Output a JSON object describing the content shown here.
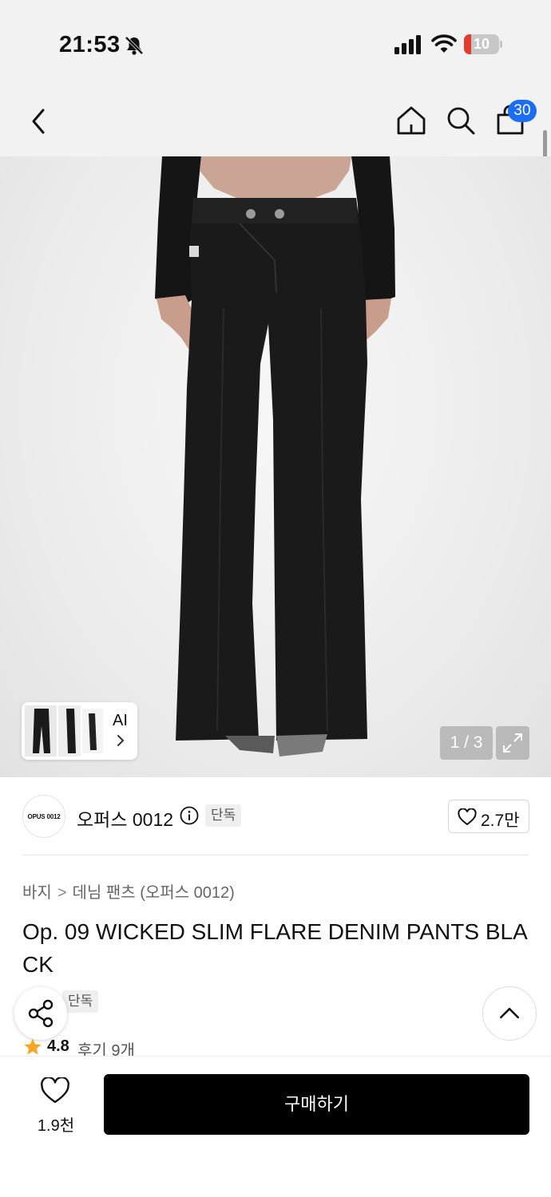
{
  "status_bar": {
    "time": "21:53",
    "battery_level": "10",
    "battery_fraction": 0.1,
    "icons": [
      "bell-off-icon",
      "signal-icon",
      "wifi-icon",
      "battery-icon"
    ]
  },
  "nav": {
    "icons": [
      "back-chevron-icon",
      "home-icon",
      "search-icon",
      "shopping-bag-icon"
    ],
    "cart_count": "30"
  },
  "gallery": {
    "ai_label": "AI",
    "counter": "1 / 3",
    "icons": [
      "chevron-right-icon",
      "expand-icon"
    ]
  },
  "brand": {
    "logo_text": "OPUS 0012",
    "name": "오퍼스 0012",
    "tag": "단독",
    "like_count": "2.7만",
    "icons": [
      "info-icon",
      "heart-icon"
    ]
  },
  "breadcrumb": {
    "items": [
      "바지",
      "데님 팬츠 (오퍼스 0012)"
    ],
    "separator": ">"
  },
  "product": {
    "title": "Op. 09 WICKED SLIM FLARE DENIM PANTS BLACK",
    "tag": "단독",
    "rating": "4.8",
    "review_link": "후기 9개"
  },
  "floating": {
    "icons": [
      "share-icon",
      "chevron-up-icon"
    ]
  },
  "bottom_bar": {
    "wish_count": "1.9천",
    "buy_label": "구매하기"
  },
  "colors": {
    "accent_blue": "#1b6ef3",
    "star": "#f5a623",
    "buy_button": "#000000",
    "battery_low": "#e33b2e"
  }
}
